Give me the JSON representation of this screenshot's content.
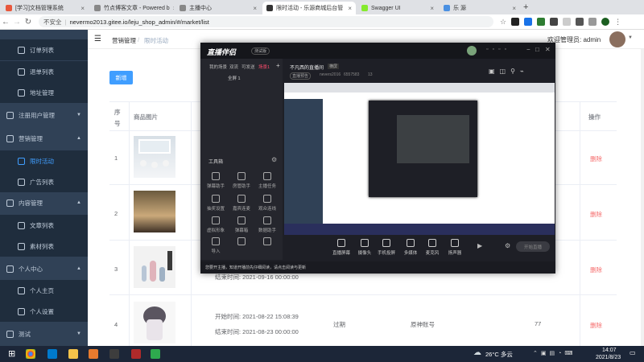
{
  "browser": {
    "tabs": [
      {
        "label": "[学习]文档管理系统",
        "color": "#e8583d"
      },
      {
        "label": "竹点博客文章 - Powered b",
        "color": "#888888"
      },
      {
        "label": "主播中心",
        "color": "#888888"
      },
      {
        "label": "限时活动 - 乐源商城后台管",
        "color": "#333333"
      },
      {
        "label": "Swagger UI",
        "color": "#85ea2d"
      },
      {
        "label": "乐 源",
        "color": "#4a90e2"
      }
    ],
    "security": "不安全",
    "url": "nevermo2013.gitee.io/leju_shop_admin/#/market/list"
  },
  "sidebar": {
    "items": [
      {
        "label": "订单列表",
        "type": "sub"
      },
      {
        "label": "退单列表",
        "type": "sub"
      },
      {
        "label": "地址管理",
        "type": "sub"
      },
      {
        "label": "注册用户管理",
        "type": "group"
      },
      {
        "label": "营销管理",
        "type": "group"
      },
      {
        "label": "限时活动",
        "type": "sub",
        "active": true
      },
      {
        "label": "广告列表",
        "type": "sub"
      },
      {
        "label": "内容管理",
        "type": "group"
      },
      {
        "label": "文章列表",
        "type": "sub"
      },
      {
        "label": "素材列表",
        "type": "sub"
      },
      {
        "label": "个人中心",
        "type": "group"
      },
      {
        "label": "个人主页",
        "type": "sub"
      },
      {
        "label": "个人设置",
        "type": "sub"
      },
      {
        "label": "测试",
        "type": "group"
      }
    ]
  },
  "header": {
    "breadcrumb": [
      "营销管理",
      "限时活动"
    ],
    "welcome": "欢迎管理员: admin"
  },
  "main": {
    "add_button": "新增",
    "col_index": "序号",
    "col_image": "商品图片",
    "col_action": "操作",
    "rows": [
      {
        "index": "1",
        "delete": "删除"
      },
      {
        "index": "2",
        "delete": "删除"
      },
      {
        "index": "3",
        "delete": "删除",
        "end_time": "结束时间: 2021-09-16 00:00:00"
      },
      {
        "index": "4",
        "delete": "删除",
        "start_time": "开始时间: 2021-08-22 15:08:39",
        "end_time": "结束时间: 2021-08-23 00:00:00",
        "status": "过期",
        "account": "原神账号",
        "count": "77"
      }
    ]
  },
  "overlay": {
    "logo": "直播伴侣",
    "version": "测试版",
    "tabs": [
      "我的场景",
      "双流",
      "可发送",
      "场景1"
    ],
    "scene_label": "全屏 1",
    "room_title": "不凡西的直播间",
    "room_badge": "横屏",
    "room_meta": [
      "直播预告",
      "nevers2016",
      "6557583",
      "13"
    ],
    "toolbox_title": "工具箱",
    "tools": [
      [
        "弹幕助手",
        "房管助手",
        "主播任务"
      ],
      [
        "抽奖设置",
        "嘉宾连麦",
        "观众连线"
      ],
      [
        "虚拟形象",
        "弹幕箱",
        "数据助手"
      ],
      [
        "导入",
        "",
        ""
      ]
    ],
    "notice": "您要开主播，知道开播前先仔细阅读，请点击阅读与更新",
    "bottom_tools": [
      "直播屏幕",
      "摄像头",
      "手机投屏",
      "多媒体",
      "麦克风",
      "扬声器"
    ],
    "start_button": "开始直播"
  },
  "taskbar": {
    "weather": "26°C 多云",
    "time": "14:07",
    "date": "2021/8/23"
  }
}
